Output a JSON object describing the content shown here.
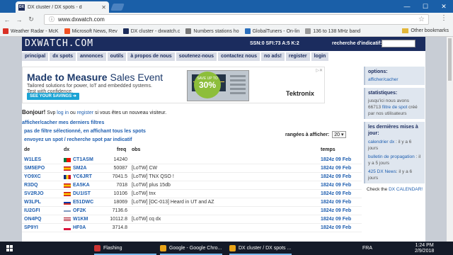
{
  "browser": {
    "tab_title": "DX cluster / DX spots - d",
    "tab_favicon": "DX",
    "url": "www.dxwatch.com",
    "other_bookmarks": "Other bookmarks",
    "bookmarks": [
      {
        "label": "Weather Radar - McK",
        "color": "#d93025"
      },
      {
        "label": "Microsoft News, Rev",
        "color": "#f25022"
      },
      {
        "label": "DX cluster - dxwatch.c",
        "color": "#1b2b5a"
      },
      {
        "label": "Numbers stations ho",
        "color": "#777777"
      },
      {
        "label": "GlobalTuners - On-lin",
        "color": "#2a6fbd"
      },
      {
        "label": "136 to 138 MHz band",
        "color": "#999999"
      }
    ]
  },
  "site": {
    "logo": "DXWATCH.COM",
    "solar": "SSN:0 SFI:73 A:5 K:2",
    "call_search_label": "recherche d'indicatif:",
    "menu": [
      "principal",
      "dx spots",
      "annonces",
      "outils",
      "à propos de nous",
      "soutenez-nous",
      "contactez nous",
      "no ads!",
      "register",
      "login"
    ]
  },
  "banner": {
    "headline_bold": "Made to Measure",
    "headline_light": " Sales Event",
    "sub1": "Tailored solutions for power, IoT and embedded systems.",
    "sub2": "Test with confidence.",
    "cta": "SEE YOUR SAVINGS ➔",
    "save_top": "SAVE UP TO",
    "save_pct": "30%",
    "brand": "Tektronix"
  },
  "welcome": {
    "bonjour": "Bonjour!",
    "text_pre": " Svp ",
    "login": "log in",
    "text_mid": " ou ",
    "register": "register",
    "text_post": " si vous êtes un nouveau visiteur."
  },
  "filters": {
    "show_hide": "afficher/cacher mes derniers filtres",
    "no_filter": "pas de filtre sélectionné, en affichant tous les spots",
    "send_spot": "envoyez un spot / recherche spot par indicatif",
    "rows_label": "rangées à afficher:",
    "rows_value": "20 ▾"
  },
  "table": {
    "headers": {
      "de": "de",
      "dx": "dx",
      "freq": "freq",
      "obs": "obs",
      "time": "temps"
    },
    "rows": [
      {
        "de": "W1LES",
        "flag": "br",
        "dx": "CT1ASM",
        "freq": "14240",
        "obs": "",
        "time": "1824z 09 Feb"
      },
      {
        "de": "SM5EPO",
        "flag": "es",
        "dx": "SM2A",
        "freq": "50087",
        "obs": "[LoTW] CW",
        "time": "1824z 09 Feb"
      },
      {
        "de": "YO9XC",
        "flag": "ro",
        "dx": "YC6JRT",
        "freq": "7041.5",
        "obs": "[LoTW] TNX QSO !",
        "time": "1824z 09 Feb"
      },
      {
        "de": "R3DQ",
        "flag": "es",
        "dx": "EA5KA",
        "freq": "7018",
        "obs": "[LoTW] plus 15db",
        "time": "1824z 09 Feb"
      },
      {
        "de": "SV2RJO",
        "flag": "es",
        "dx": "DU1IST",
        "freq": "10106",
        "obs": "[LoTW] tnx",
        "time": "1824z 09 Feb"
      },
      {
        "de": "W3LPL",
        "flag": "ru",
        "dx": "E51DWC",
        "freq": "18069",
        "obs": "[LoTW] [OC-013] Heard in UT and AZ",
        "time": "1824z 09 Feb"
      },
      {
        "de": "IU2GFI",
        "flag": "fi",
        "dx": "OF2K",
        "freq": "7136.6",
        "obs": "",
        "time": "1824z 09 Feb"
      },
      {
        "de": "ON4PQ",
        "flag": "us",
        "dx": "W1KM",
        "freq": "10112.8",
        "obs": "[LoTW] cq dx",
        "time": "1824z 09 Feb"
      },
      {
        "de": "SP9YI",
        "flag": "pl",
        "dx": "HF0A",
        "freq": "3714.8",
        "obs": "",
        "time": "1824z 09 Feb"
      }
    ]
  },
  "sidebar": {
    "options_title": "options:",
    "options_link": "afficher/cacher",
    "stats_title": "statistiques:",
    "stats_line1": "jusqu'ici nous avons",
    "stats_num": "66713",
    "stats_link": "filtre de spot",
    "stats_line2": " créé par nos utilisateurs",
    "updates_title": "les dernières mises à jour:",
    "updates": [
      {
        "link": "calendrier dx",
        "text": " : il y a 6 jours"
      },
      {
        "link": "bulletin de propagation",
        "text": " : il y a 5 jours"
      },
      {
        "link": "425 DX News",
        "text": ": il y a 6 jours"
      }
    ],
    "check_pre": "Check the ",
    "check_link": "DX CALENDAR!"
  },
  "taskbar": {
    "apps": [
      {
        "label": "Flashing",
        "color": "#c33"
      },
      {
        "label": "Google - Google Chro...",
        "color": "#e8a317"
      },
      {
        "label": "DX cluster / DX spots ...",
        "color": "#e8a317"
      }
    ],
    "lang": "FRA",
    "time": "1:24 PM",
    "date": "2/9/2018"
  }
}
